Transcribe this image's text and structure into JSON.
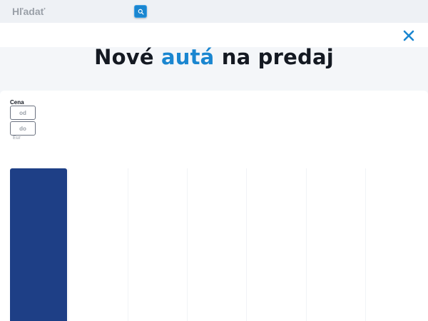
{
  "search": {
    "placeholder": "Hľadať"
  },
  "heading": {
    "part1": "Nové ",
    "accent": "autá",
    "part2": " na predaj"
  },
  "filters": {
    "price": {
      "label": "Cena",
      "from_placeholder": "od",
      "to_placeholder": "do",
      "currency": "Eur"
    }
  },
  "cards": [
    {
      "active": true
    },
    {
      "active": false
    },
    {
      "active": false
    },
    {
      "active": false
    },
    {
      "active": false
    },
    {
      "active": false
    },
    {
      "active": false
    }
  ],
  "icons": {
    "search": "search-icon",
    "close": "close-icon"
  },
  "colors": {
    "accent": "#1a86d0",
    "card_active": "#1e3f86",
    "heading": "#141922",
    "background": "#f4f6f9"
  }
}
